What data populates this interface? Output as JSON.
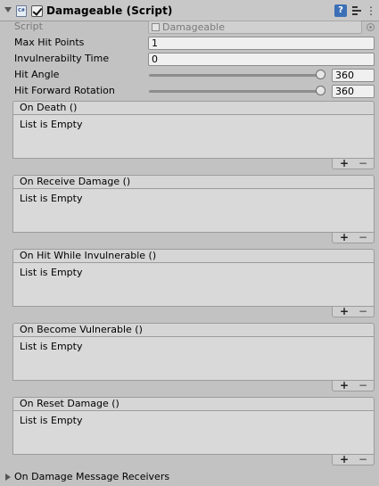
{
  "component": {
    "title": "Damageable (Script)",
    "script_label": "Script",
    "script_value": "Damageable",
    "script_icon_text": "C#"
  },
  "fields": {
    "max_hit_points": {
      "label": "Max Hit Points",
      "value": "1"
    },
    "invulnerability_time": {
      "label": "Invulnerabilty Time",
      "value": "0"
    },
    "hit_angle": {
      "label": "Hit Angle",
      "value": "360",
      "slider_fraction": 1.0
    },
    "hit_forward_rotation": {
      "label": "Hit Forward Rotation",
      "value": "360",
      "slider_fraction": 1.0
    }
  },
  "events": [
    {
      "header": "On Death ()",
      "body": "List is Empty"
    },
    {
      "header": "On Receive Damage ()",
      "body": "List is Empty"
    },
    {
      "header": "On Hit While Invulnerable ()",
      "body": "List is Empty"
    },
    {
      "header": "On Become Vulnerable ()",
      "body": "List is Empty"
    },
    {
      "header": "On Reset Damage ()",
      "body": "List is Empty"
    }
  ],
  "list_buttons": {
    "add": "+",
    "remove": "−"
  },
  "foldout": {
    "label": "On Damage Message Receivers",
    "expanded": false
  },
  "icons": {
    "help": "help-icon",
    "presets": "preset-icon",
    "settings": "gear-icon",
    "enable": "checkbox-icon",
    "help_glyph": "?"
  }
}
